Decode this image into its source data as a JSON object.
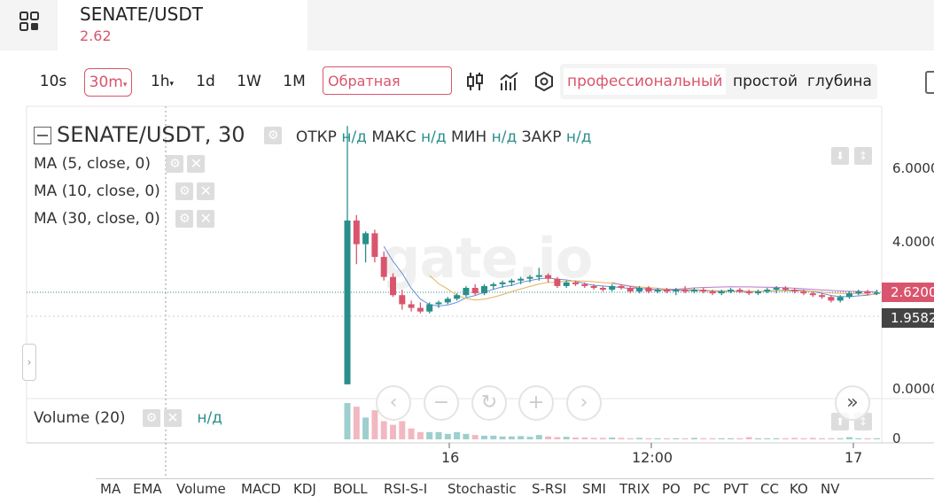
{
  "header": {
    "pair": "SENATE/USDT",
    "price": "2.62"
  },
  "toolbar": {
    "timeframes": [
      "10s",
      "30m",
      "1h",
      "1d",
      "1W",
      "1M"
    ],
    "active_timeframe": "30m",
    "adjust_select": "Обратная",
    "mode_tabs": [
      "профессиональный",
      "простой",
      "глубина"
    ],
    "active_mode": "профессиональный"
  },
  "legend": {
    "title": "SENATE/USDT, 30",
    "open_label": "ОТКР",
    "open_value": "н/д",
    "high_label": "МАКС",
    "high_value": "н/д",
    "low_label": "МИН",
    "low_value": "н/д",
    "close_label": "ЗАКР",
    "close_value": "н/д",
    "ma_rows": [
      "MA (5, close, 0)",
      "MA (10, close, 0)",
      "MA (30, close, 0)"
    ],
    "gear_glyph": "⚙",
    "close_glyph": "✕"
  },
  "volume": {
    "title": "Volume (20)",
    "value": "н/д"
  },
  "axis": {
    "price_labels": [
      "6.0000",
      "4.0000",
      "0.0000"
    ],
    "volume_label": "0",
    "last_price": "2.6200",
    "marker_price": "1.9582",
    "time_labels": [
      "16",
      "12:00",
      "17"
    ]
  },
  "watermark": "gate.io",
  "nav": {
    "buttons": [
      "‹",
      "−",
      "↻",
      "+",
      "›",
      "»"
    ],
    "side_handle": "›"
  },
  "indicators": [
    "MA",
    "EMA",
    "Volume",
    "MACD",
    "KDJ",
    "BOLL",
    "RSI-S-I",
    "Stochastic",
    "S-RSI",
    "SMI",
    "TRIX",
    "PO",
    "PC",
    "PVT",
    "CC",
    "KO",
    "NV"
  ],
  "colors": {
    "accent": "#d9556d",
    "up": "#2a8f8c",
    "down": "#d9556d",
    "last_price_tag": "#d9556d",
    "marker_tag": "#444444"
  },
  "chart_data": {
    "type": "candlestick",
    "candles": [
      {
        "o": 0.1,
        "h": 7.2,
        "l": 0.1,
        "c": 4.6
      },
      {
        "o": 4.6,
        "h": 4.75,
        "l": 3.4,
        "c": 3.95
      },
      {
        "o": 3.95,
        "h": 4.3,
        "l": 3.45,
        "c": 4.25
      },
      {
        "o": 4.25,
        "h": 4.35,
        "l": 3.45,
        "c": 3.6
      },
      {
        "o": 3.6,
        "h": 3.75,
        "l": 2.95,
        "c": 3.05
      },
      {
        "o": 3.05,
        "h": 3.15,
        "l": 2.5,
        "c": 2.55
      },
      {
        "o": 2.55,
        "h": 2.7,
        "l": 2.15,
        "c": 2.3
      },
      {
        "o": 2.3,
        "h": 2.4,
        "l": 2.1,
        "c": 2.2
      },
      {
        "o": 2.2,
        "h": 2.35,
        "l": 2.05,
        "c": 2.1
      },
      {
        "o": 2.1,
        "h": 2.35,
        "l": 2.05,
        "c": 2.3
      },
      {
        "o": 2.3,
        "h": 2.4,
        "l": 2.2,
        "c": 2.35
      },
      {
        "o": 2.35,
        "h": 2.5,
        "l": 2.3,
        "c": 2.45
      },
      {
        "o": 2.45,
        "h": 2.6,
        "l": 2.4,
        "c": 2.55
      },
      {
        "o": 2.55,
        "h": 2.8,
        "l": 2.5,
        "c": 2.75
      },
      {
        "o": 2.75,
        "h": 2.85,
        "l": 2.55,
        "c": 2.6
      },
      {
        "o": 2.6,
        "h": 2.85,
        "l": 2.55,
        "c": 2.8
      },
      {
        "o": 2.8,
        "h": 2.9,
        "l": 2.7,
        "c": 2.85
      },
      {
        "o": 2.85,
        "h": 2.95,
        "l": 2.75,
        "c": 2.9
      },
      {
        "o": 2.9,
        "h": 3.0,
        "l": 2.8,
        "c": 2.95
      },
      {
        "o": 2.95,
        "h": 3.05,
        "l": 2.85,
        "c": 3.0
      },
      {
        "o": 3.0,
        "h": 3.1,
        "l": 2.9,
        "c": 3.05
      },
      {
        "o": 3.05,
        "h": 3.3,
        "l": 2.95,
        "c": 3.1
      },
      {
        "o": 3.1,
        "h": 3.15,
        "l": 2.9,
        "c": 3.0
      },
      {
        "o": 3.0,
        "h": 3.05,
        "l": 2.75,
        "c": 2.8
      },
      {
        "o": 2.8,
        "h": 2.95,
        "l": 2.75,
        "c": 2.9
      },
      {
        "o": 2.9,
        "h": 2.95,
        "l": 2.8,
        "c": 2.85
      },
      {
        "o": 2.85,
        "h": 2.9,
        "l": 2.75,
        "c": 2.8
      },
      {
        "o": 2.8,
        "h": 2.85,
        "l": 2.7,
        "c": 2.75
      },
      {
        "o": 2.75,
        "h": 2.8,
        "l": 2.65,
        "c": 2.7
      },
      {
        "o": 2.7,
        "h": 2.85,
        "l": 2.65,
        "c": 2.8
      },
      {
        "o": 2.8,
        "h": 2.85,
        "l": 2.7,
        "c": 2.75
      },
      {
        "o": 2.75,
        "h": 2.8,
        "l": 2.6,
        "c": 2.65
      },
      {
        "o": 2.65,
        "h": 2.8,
        "l": 2.6,
        "c": 2.75
      },
      {
        "o": 2.75,
        "h": 2.8,
        "l": 2.6,
        "c": 2.65
      },
      {
        "o": 2.65,
        "h": 2.75,
        "l": 2.6,
        "c": 2.7
      },
      {
        "o": 2.7,
        "h": 2.75,
        "l": 2.6,
        "c": 2.65
      },
      {
        "o": 2.65,
        "h": 2.75,
        "l": 2.55,
        "c": 2.7
      },
      {
        "o": 2.7,
        "h": 2.8,
        "l": 2.6,
        "c": 2.65
      },
      {
        "o": 2.65,
        "h": 2.75,
        "l": 2.6,
        "c": 2.7
      },
      {
        "o": 2.7,
        "h": 2.75,
        "l": 2.6,
        "c": 2.65
      },
      {
        "o": 2.65,
        "h": 2.7,
        "l": 2.55,
        "c": 2.6
      },
      {
        "o": 2.6,
        "h": 2.7,
        "l": 2.55,
        "c": 2.65
      },
      {
        "o": 2.65,
        "h": 2.75,
        "l": 2.6,
        "c": 2.7
      },
      {
        "o": 2.7,
        "h": 2.75,
        "l": 2.6,
        "c": 2.65
      },
      {
        "o": 2.65,
        "h": 2.7,
        "l": 2.55,
        "c": 2.6
      },
      {
        "o": 2.6,
        "h": 2.7,
        "l": 2.55,
        "c": 2.65
      },
      {
        "o": 2.65,
        "h": 2.75,
        "l": 2.6,
        "c": 2.7
      },
      {
        "o": 2.7,
        "h": 2.8,
        "l": 2.6,
        "c": 2.75
      },
      {
        "o": 2.75,
        "h": 2.8,
        "l": 2.65,
        "c": 2.7
      },
      {
        "o": 2.7,
        "h": 2.75,
        "l": 2.6,
        "c": 2.65
      },
      {
        "o": 2.65,
        "h": 2.7,
        "l": 2.55,
        "c": 2.6
      },
      {
        "o": 2.6,
        "h": 2.65,
        "l": 2.5,
        "c": 2.55
      },
      {
        "o": 2.55,
        "h": 2.6,
        "l": 2.45,
        "c": 2.5
      },
      {
        "o": 2.5,
        "h": 2.55,
        "l": 2.35,
        "c": 2.4
      },
      {
        "o": 2.4,
        "h": 2.55,
        "l": 2.35,
        "c": 2.5
      },
      {
        "o": 2.5,
        "h": 2.65,
        "l": 2.45,
        "c": 2.6
      },
      {
        "o": 2.6,
        "h": 2.7,
        "l": 2.55,
        "c": 2.65
      },
      {
        "o": 2.65,
        "h": 2.7,
        "l": 2.55,
        "c": 2.6
      },
      {
        "o": 2.6,
        "h": 2.7,
        "l": 2.55,
        "c": 2.62
      }
    ],
    "volumes": [
      10,
      9,
      6,
      8,
      5,
      4,
      5,
      3,
      2,
      2,
      2,
      1.5,
      2,
      1.5,
      1.2,
      1,
      1,
      0.8,
      0.8,
      0.9,
      0.7,
      1.2,
      0.8,
      0.6,
      0.7,
      0.5,
      0.5,
      0.4,
      0.4,
      0.5,
      0.4,
      0.3,
      0.4,
      0.3,
      0.3,
      0.3,
      0.3,
      0.3,
      0.4,
      0.3,
      0.3,
      0.3,
      0.3,
      0.3,
      0.6,
      0.3,
      0.3,
      0.3,
      0.3,
      0.4,
      0.3,
      0.4,
      0.3,
      0.3,
      0.3,
      0.6,
      0.3,
      0.3,
      0.3
    ],
    "ylim": [
      0,
      7.3
    ],
    "last": 2.62,
    "marker": 1.9582
  }
}
